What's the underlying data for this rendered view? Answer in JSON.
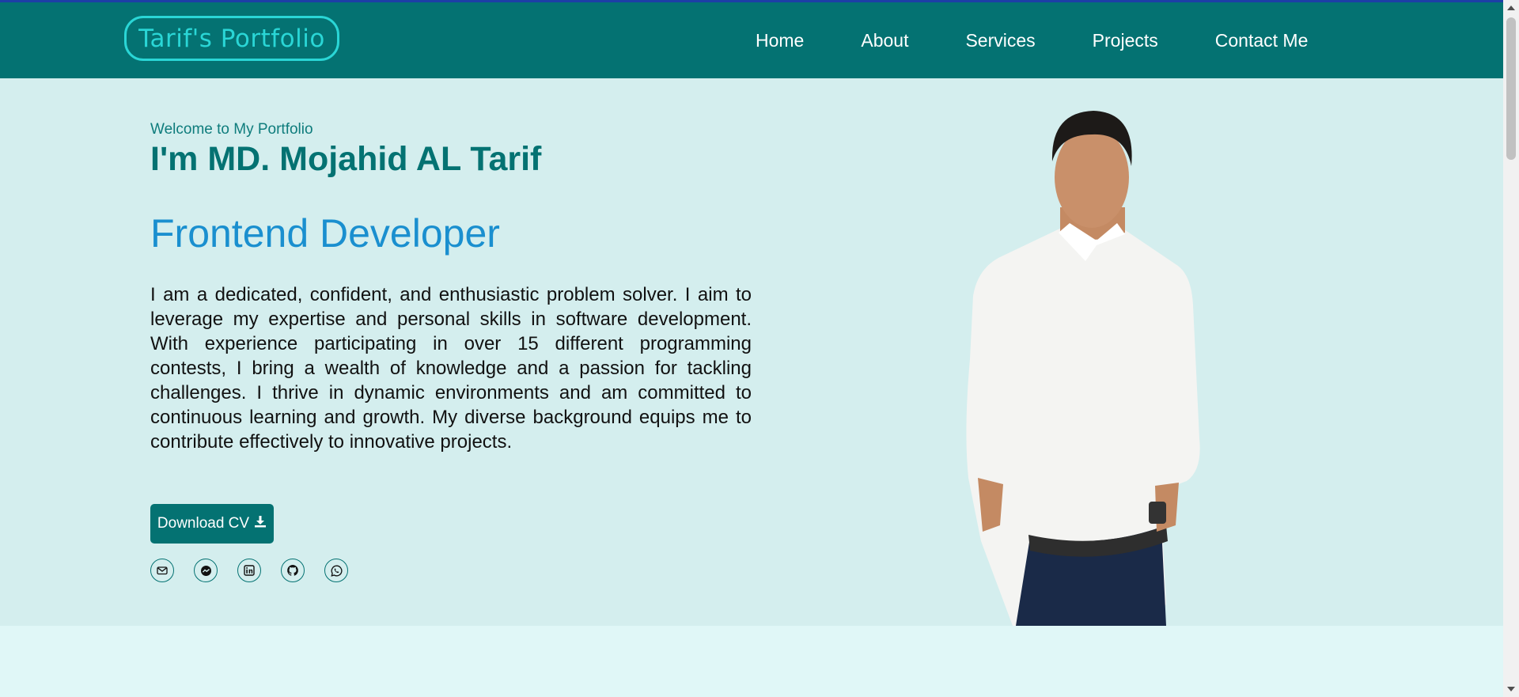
{
  "header": {
    "logo": "Tarif's Portfolio",
    "nav": [
      "Home",
      "About",
      "Services",
      "Projects",
      "Contact Me"
    ]
  },
  "hero": {
    "welcome": "Welcome to My Portfolio",
    "name": "I'm MD. Mojahid AL Tarif",
    "role": "Frontend Developer",
    "bio": "I am a dedicated, confident, and enthusiastic problem solver. I aim to leverage my expertise and personal skills in software development. With experience participating in over 15 different programming contests, I bring a wealth of knowledge and a passion for tackling challenges. I thrive in dynamic environments and am committed to continuous learning and growth. My diverse background equips me to contribute effectively to innovative projects.",
    "cv_button": "Download CV",
    "cv_icon": "download-icon",
    "socials": [
      "email-icon",
      "messenger-icon",
      "linkedin-icon",
      "github-icon",
      "whatsapp-icon"
    ]
  },
  "colors": {
    "navbar": "#047272",
    "logo_accent": "#2ad6d6",
    "hero_bg": "#d4eeee",
    "role_text": "#1a8fcf"
  }
}
